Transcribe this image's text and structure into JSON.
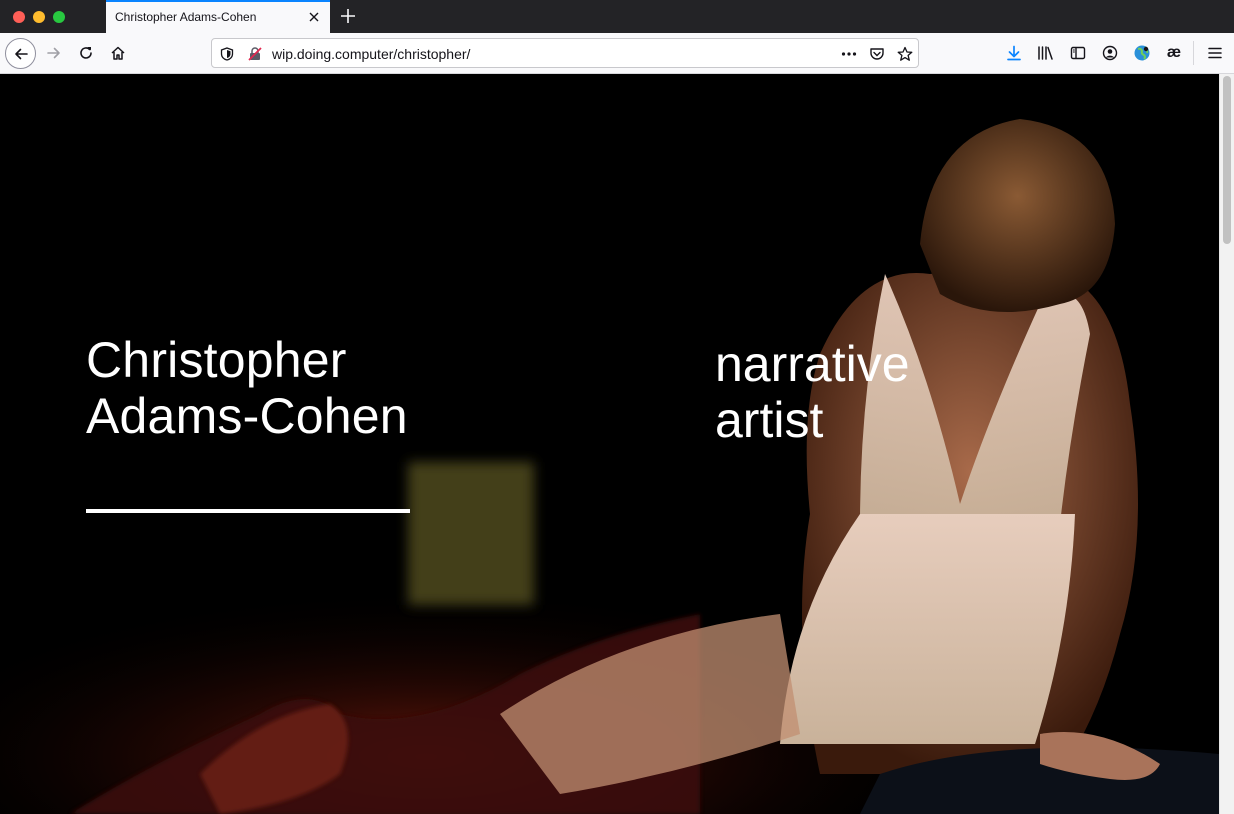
{
  "browser": {
    "tab": {
      "title": "Christopher Adams-Cohen"
    },
    "url": "wip.doing.computer/christopher/",
    "icons": {
      "back": "arrow-left-icon",
      "forward": "arrow-right-icon",
      "reload": "reload-icon",
      "home": "home-icon",
      "tracking": "shield-icon",
      "insecure": "insecure-lock-icon",
      "more": "ellipsis-icon",
      "pocket": "pocket-icon",
      "bookmark": "star-icon",
      "downloads": "download-icon",
      "library": "library-icon",
      "sidebar": "sidebar-icon",
      "account": "account-icon",
      "extension_globe": "globe-icon",
      "menu": "hamburger-icon"
    },
    "extension_label": "æ",
    "colors": {
      "accent": "#0a84ff",
      "download": "#0a84ff"
    }
  },
  "page": {
    "name_line1": "Christopher",
    "name_line2": "Adams-Cohen",
    "tagline_line1": "narrative",
    "tagline_line2": "artist",
    "hero_image": "stage-performance-photo"
  }
}
